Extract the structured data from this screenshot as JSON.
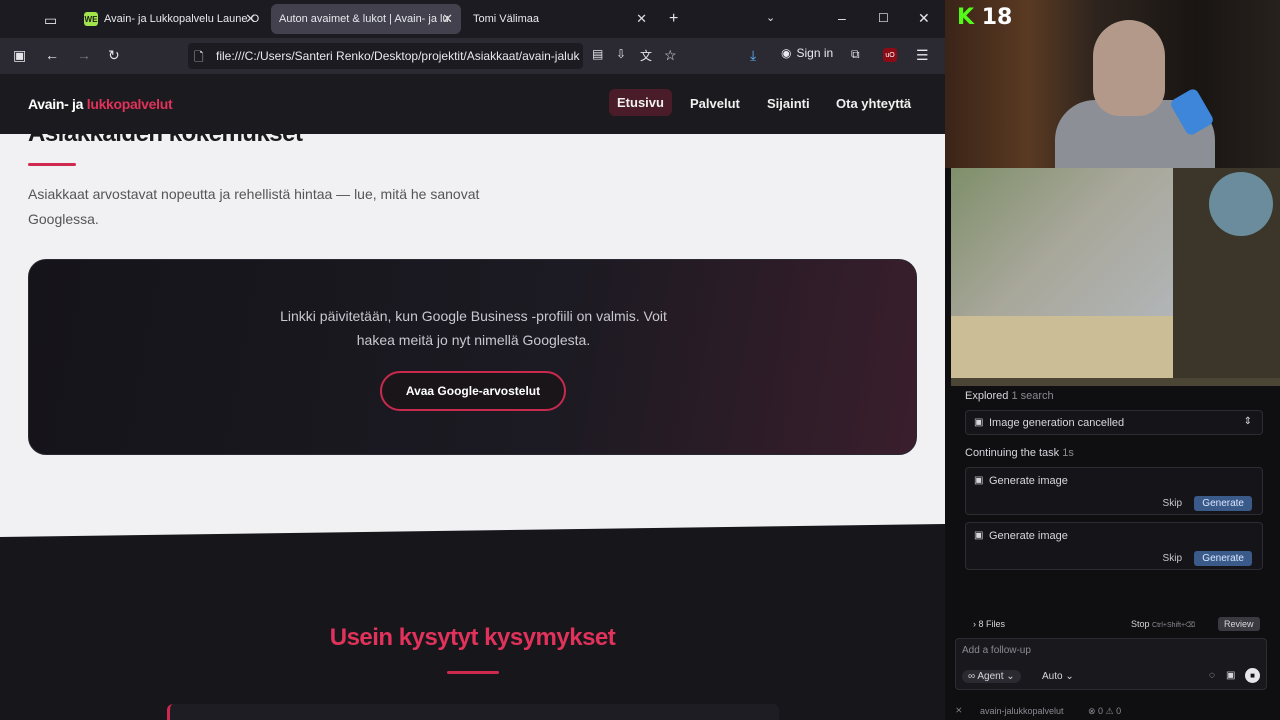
{
  "browser": {
    "tabs": [
      {
        "label": "Avain- ja Lukkopalvelu Laune O",
        "favicon": "WE"
      },
      {
        "label": "Auton avaimet & lukot | Avain- ja lu"
      },
      {
        "label": "Tomi Välimaa"
      }
    ],
    "url": "file:///C:/Users/Santeri Renko/Desktop/projektit/Asiakkaat/avain-jaluk",
    "signin": "Sign in"
  },
  "site": {
    "logo_white": "Avain- ja ",
    "logo_accent": "lukkopalvelut",
    "nav": [
      "Etusivu",
      "Palvelut",
      "Sijainti",
      "Ota yhteyttä"
    ],
    "section_title": "Asiakkaiden kokemukset",
    "intro": "Asiakkaat arvostavat nopeutta ja rehellistä hintaa — lue, mitä he sanovat Googlessa.",
    "card_line1": "Linkki päivitetään, kun Google Business -profiili on valmis. Voit",
    "card_line2": "hakea meitä jo nyt nimellä Googlesta.",
    "card_button": "Avaa Google-arvostelut",
    "faq_title": "Usein kysytyt kysymykset"
  },
  "stream": {
    "logo_k": "K",
    "logo_num": "18"
  },
  "agent": {
    "explored": "Explored",
    "explored_detail": "1 search",
    "cancelled": "Image generation cancelled",
    "continuing": "Continuing the task",
    "continuing_time": "1s",
    "gen1": "Generate image",
    "gen2": "Generate image",
    "skip": "Skip",
    "generate": "Generate",
    "files": "8 Files",
    "stop": "Stop",
    "stop_shortcut": "Ctrl+Shift+⌫",
    "review": "Review",
    "followup_placeholder": "Add a follow-up",
    "mode": "Agent",
    "model": "Auto",
    "status_project": "avain-jalukkopalvelut",
    "status_counts": "⊗ 0 ⚠ 0"
  }
}
